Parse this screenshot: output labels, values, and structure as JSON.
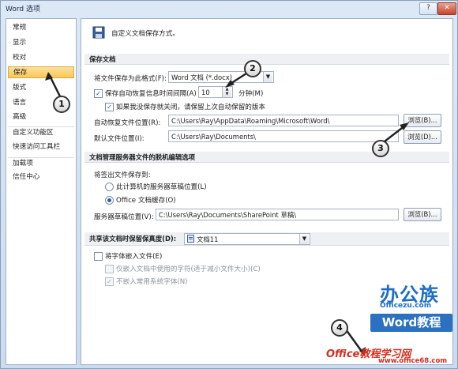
{
  "window": {
    "title": "Word 选项",
    "help_icon": "?",
    "close_icon": "✕"
  },
  "sidebar": {
    "items": [
      {
        "label": "常规"
      },
      {
        "label": "显示"
      },
      {
        "label": "校对"
      },
      {
        "label": "保存",
        "selected": true
      },
      {
        "label": "版式"
      },
      {
        "label": "语言"
      },
      {
        "label": "高级"
      },
      {
        "label": "自定义功能区"
      },
      {
        "label": "快速访问工具栏"
      },
      {
        "label": "加载项"
      },
      {
        "label": "信任中心"
      }
    ]
  },
  "main": {
    "header_text": "自定义文档保存方式。",
    "save_docs": {
      "section_title": "保存文档",
      "format_label": "将文件保存为此格式(F):",
      "format_value": "Word 文档 (*.docx)",
      "autorecover_label": "保存自动恢复信息时间间隔(A)",
      "autorecover_checked": true,
      "autorecover_minutes": "10",
      "minutes_unit": "分钟(M)",
      "keep_last_label": "如果我没保存就关闭，请保留上次自动保留的版本",
      "keep_last_checked": true,
      "autorecover_location_label": "自动恢复文件位置(R):",
      "autorecover_location_value": "C:\\Users\\Ray\\AppData\\Roaming\\Microsoft\\Word\\",
      "default_location_label": "默认文件位置(I):",
      "default_location_value": "C:\\Users\\Ray\\Documents\\",
      "browse1": "浏览(B)...",
      "browse2": "浏览(D)..."
    },
    "offline": {
      "section_title": "文档管理服务器文件的脱机编辑选项",
      "save_checkout_label": "将签出文件保存到:",
      "opt_server": "此计算机的服务器草稿位置(L)",
      "opt_cache": "Office 文档缓存(O)",
      "selected": "cache",
      "drafts_label": "服务器草稿位置(V):",
      "drafts_value": "C:\\Users\\Ray\\Documents\\SharePoint 草稿\\",
      "browse3": "浏览(B)..."
    },
    "fidelity": {
      "section_title": "共享该文档时保留保真度(D):",
      "doc_value": "文档11",
      "embed_fonts": "将字体嵌入文件(E)",
      "embed_used_only": "仅嵌入文档中使用的字符(适于减小文件大小)(C)",
      "no_common_fonts": "不嵌入常用系统字体(N)",
      "embed_fonts_checked": false,
      "no_common_checked": true
    }
  },
  "callouts": [
    "1",
    "2",
    "3",
    "4"
  ],
  "watermark": {
    "line1": "办公族",
    "line2": "Officezu.com",
    "line3": "Word教程",
    "line4": "Office教程学习网",
    "line5": "www.office68.com"
  },
  "colors": {
    "selected_nav": "#f8c85a",
    "accent_blue": "#2b71c0",
    "watermark_red": "#d42d1f"
  }
}
